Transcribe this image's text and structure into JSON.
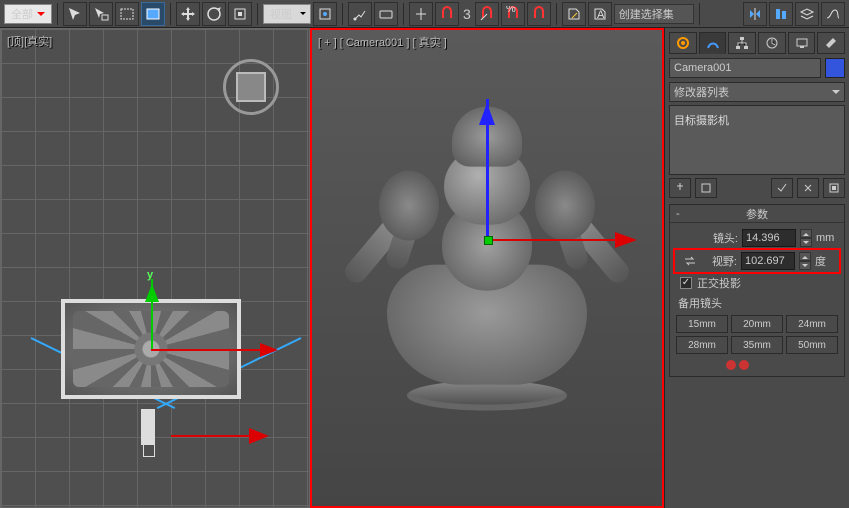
{
  "toolbar": {
    "selection_filter": "全部",
    "view_dropdown": "视图",
    "named_set_placeholder": "创建选择集",
    "number_label": "3"
  },
  "viewports": {
    "left_label": "[顶][真实]",
    "right_label": "[ + ] [ Camera001 ] [ 真实 ]",
    "left_y_axis": "y"
  },
  "panel": {
    "object_name": "Camera001",
    "modifier_dropdown": "修改器列表",
    "stack_item": "目标摄影机",
    "rollout_title": "参数",
    "lens": {
      "label": "镜头:",
      "value": "14.396",
      "unit": "mm"
    },
    "fov": {
      "label": "视野:",
      "value": "102.697",
      "unit": "度"
    },
    "ortho": {
      "label": "正交投影",
      "checked": true
    },
    "presets_label": "备用镜头",
    "presets": [
      "15mm",
      "20mm",
      "24mm",
      "28mm",
      "35mm",
      "50mm"
    ]
  }
}
